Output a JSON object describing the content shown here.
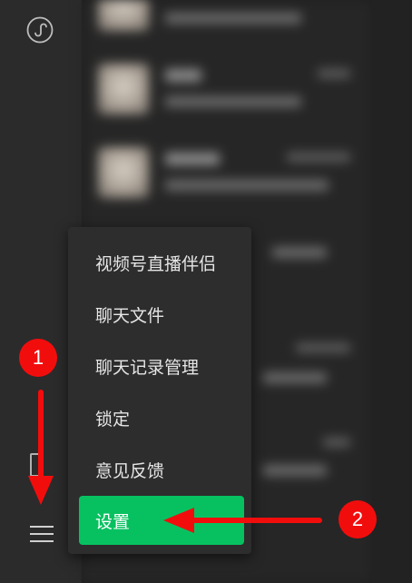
{
  "menu": {
    "items": [
      {
        "label": "视频号直播伴侣"
      },
      {
        "label": "聊天文件"
      },
      {
        "label": "聊天记录管理"
      },
      {
        "label": "锁定"
      },
      {
        "label": "意见反馈"
      },
      {
        "label": "设置"
      }
    ],
    "selected": "设置"
  },
  "annotations": {
    "step1": "1",
    "step2": "2"
  },
  "icons": {
    "mini_program": "mini-program-icon",
    "menu": "hamburger-menu-icon"
  },
  "colors": {
    "accent": "#07c160",
    "annotation": "#f20d0d",
    "menu_bg": "#2d2d2d",
    "sidebar_bg": "#2b2b2b"
  }
}
